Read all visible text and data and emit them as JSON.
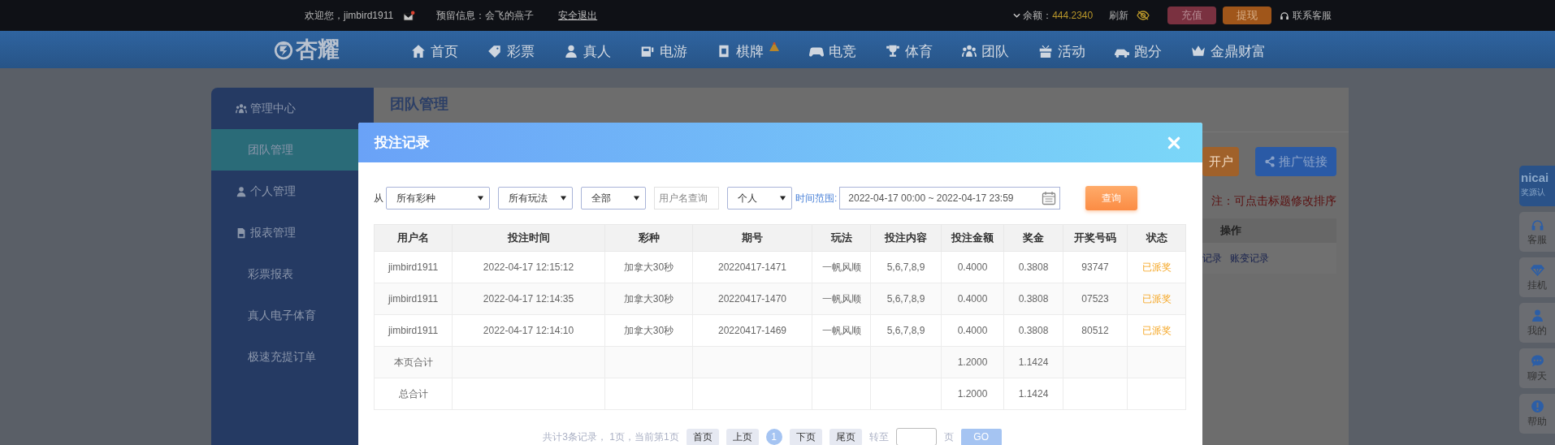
{
  "top_bar": {
    "greeting": "欢迎您，jimbird1911",
    "reserved_info": "预留信息：会飞的燕子",
    "logout": "安全退出",
    "balance_label": "余额：",
    "balance": "444.2340",
    "refresh": "刷新",
    "deposit": "充值",
    "withdraw": "提现",
    "support": "联系客服"
  },
  "nav": {
    "logo": "杏耀",
    "items": [
      {
        "label": "首页",
        "badge": false
      },
      {
        "label": "彩票",
        "badge": false
      },
      {
        "label": "真人",
        "badge": false
      },
      {
        "label": "电游",
        "badge": false
      },
      {
        "label": "棋牌",
        "badge": true
      },
      {
        "label": "电竞",
        "badge": false
      },
      {
        "label": "体育",
        "badge": false
      },
      {
        "label": "团队",
        "badge": false
      },
      {
        "label": "活动",
        "badge": false
      },
      {
        "label": "跑分",
        "badge": false
      },
      {
        "label": "金鼎财富",
        "badge": false
      }
    ]
  },
  "sidebar": {
    "items": [
      {
        "label": "管理中心",
        "kind": "header",
        "selected": false
      },
      {
        "label": "团队管理",
        "kind": "sub",
        "selected": true
      },
      {
        "label": "个人管理",
        "kind": "header",
        "selected": false
      },
      {
        "label": "报表管理",
        "kind": "header",
        "selected": false
      },
      {
        "label": "彩票报表",
        "kind": "sub",
        "selected": false
      },
      {
        "label": "真人电子体育",
        "kind": "sub",
        "selected": false
      },
      {
        "label": "极速充提订单",
        "kind": "sub",
        "selected": false
      }
    ]
  },
  "panel": {
    "title": "团队管理",
    "register_button": "开户",
    "promo_button": "推广链接",
    "note": "注：可点击标题修改排序",
    "table": {
      "column": "操作",
      "links": [
        "记录",
        "账变记录"
      ]
    }
  },
  "side_float": {
    "logo_text": "nicai",
    "logo_sub": "奖源认",
    "items": [
      {
        "label": "客服"
      },
      {
        "label": "挂机"
      },
      {
        "label": "我的"
      },
      {
        "label": "聊天"
      },
      {
        "label": "帮助"
      }
    ]
  },
  "modal": {
    "title": "投注记录",
    "filters": {
      "from": "从",
      "lottery": "所有彩种",
      "play": "所有玩法",
      "status": "全部",
      "username_placeholder": "用户名查询",
      "scope": "个人",
      "range_label": "时间范围:",
      "range": "2022-04-17 00:00 ~ 2022-04-17 23:59",
      "search": "查询"
    },
    "table": {
      "columns": [
        "用户名",
        "投注时间",
        "彩种",
        "期号",
        "玩法",
        "投注内容",
        "投注金额",
        "奖金",
        "开奖号码",
        "状态"
      ],
      "rows": [
        {
          "kind": "record",
          "cells": [
            "jimbird1911",
            "2022-04-17 12:15:12",
            "加拿大30秒",
            "20220417-1471",
            "一帆风顺",
            "5,6,7,8,9",
            "0.4000",
            "0.3808",
            "93747",
            "已派奖"
          ]
        },
        {
          "kind": "record",
          "cells": [
            "jimbird1911",
            "2022-04-17 12:14:35",
            "加拿大30秒",
            "20220417-1470",
            "一帆风顺",
            "5,6,7,8,9",
            "0.4000",
            "0.3808",
            "07523",
            "已派奖"
          ]
        },
        {
          "kind": "record",
          "cells": [
            "jimbird1911",
            "2022-04-17 12:14:10",
            "加拿大30秒",
            "20220417-1469",
            "一帆风顺",
            "5,6,7,8,9",
            "0.4000",
            "0.3808",
            "80512",
            "已派奖"
          ]
        },
        {
          "kind": "summary",
          "label": "本页合计",
          "amount": "1.2000",
          "prize": "1.1424"
        },
        {
          "kind": "summary",
          "label": "总合计",
          "amount": "1.2000",
          "prize": "1.1424"
        }
      ]
    },
    "pagination": {
      "summary": "共计3条记录， 1页，当前第1页",
      "first": "首页",
      "prev": "上页",
      "pages": [
        {
          "label": "1",
          "selected": true
        }
      ],
      "next": "下页",
      "last": "尾页",
      "goto": "转至",
      "page_unit": "页",
      "go": "GO"
    }
  }
}
